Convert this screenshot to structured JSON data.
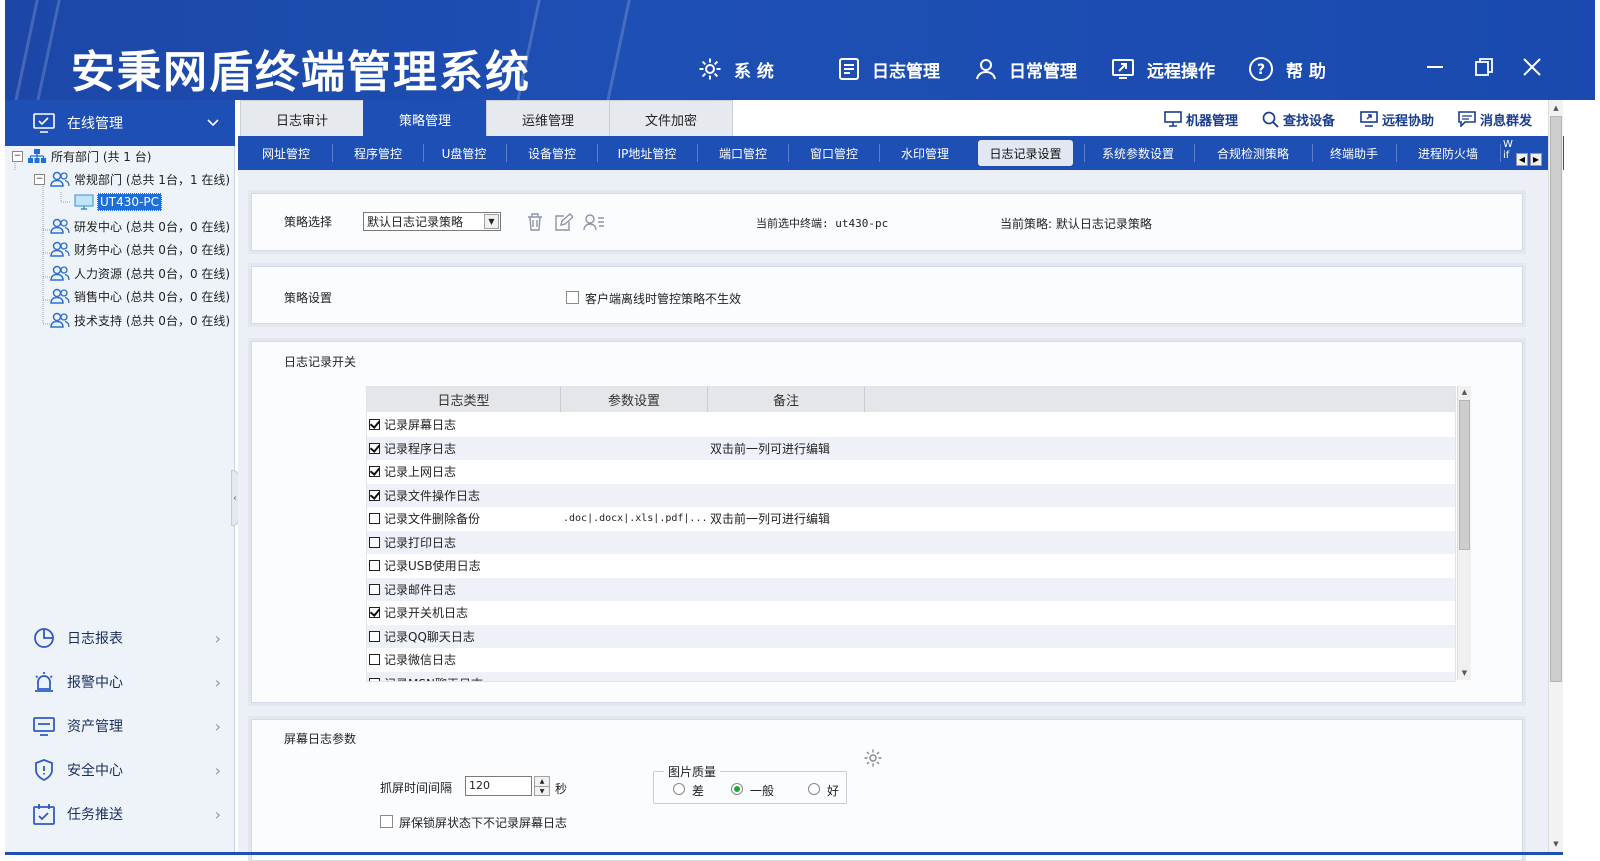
{
  "app": {
    "title": "安秉网盾终端管理系统"
  },
  "header_menu": [
    {
      "label": "系 统",
      "icon": "gear-icon"
    },
    {
      "label": "日志管理",
      "icon": "document-icon"
    },
    {
      "label": "日常管理",
      "icon": "user-icon"
    },
    {
      "label": "远程操作",
      "icon": "remote-icon"
    },
    {
      "label": "帮 助",
      "icon": "help-icon"
    }
  ],
  "sidebar": {
    "online_label": "在线管理",
    "tree": [
      {
        "label": "所有部门 (共 1 台)"
      },
      {
        "label": "常规部门 (总共 1台，1 在线)"
      },
      {
        "label": "UT430-PC"
      },
      {
        "label": "研发中心 (总共 0台，0 在线)"
      },
      {
        "label": "财务中心 (总共 0台，0 在线)"
      },
      {
        "label": "人力资源 (总共 0台，0 在线)"
      },
      {
        "label": "销售中心 (总共 0台，0 在线)"
      },
      {
        "label": "技术支持 (总共 0台，0 在线)"
      }
    ],
    "nav": [
      {
        "label": "日志报表"
      },
      {
        "label": "报警中心"
      },
      {
        "label": "资产管理"
      },
      {
        "label": "安全中心"
      },
      {
        "label": "任务推送"
      }
    ]
  },
  "main_tabs": [
    "日志审计",
    "策略管理",
    "运维管理",
    "文件加密"
  ],
  "toolbar_links": [
    "机器管理",
    "查找设备",
    "远程协助",
    "消息群发"
  ],
  "sub_tabs": [
    "网址管控",
    "程序管控",
    "U盘管控",
    "设备管控",
    "IP地址管控",
    "端口管控",
    "窗口管控",
    "水印管理",
    "日志记录设置",
    "系统参数设置",
    "合规检测策略",
    "终端助手",
    "进程防火墙"
  ],
  "sub_tab_overflow": "W\nif",
  "policy": {
    "select_label": "策略选择",
    "select_value": "默认日志记录策略",
    "current_terminal": "当前选中终端: ut430-pc",
    "current_policy": "当前策略: 默认日志记录策略"
  },
  "policy_settings": {
    "label": "策略设置",
    "offline_checkbox": "客户端离线时管控策略不生效"
  },
  "log_switch": {
    "title": "日志记录开关",
    "columns": [
      "日志类型",
      "参数设置",
      "备注"
    ],
    "rows": [
      {
        "checked": true,
        "type": "记录屏幕日志",
        "param": "",
        "note": ""
      },
      {
        "checked": true,
        "type": "记录程序日志",
        "param": "",
        "note": "双击前一列可进行编辑"
      },
      {
        "checked": true,
        "type": "记录上网日志",
        "param": "",
        "note": ""
      },
      {
        "checked": true,
        "type": "记录文件操作日志",
        "param": "",
        "note": ""
      },
      {
        "checked": false,
        "type": "记录文件删除备份",
        "param": ".doc|.docx|.xls|.pdf|...",
        "note": "双击前一列可进行编辑"
      },
      {
        "checked": false,
        "type": "记录打印日志",
        "param": "",
        "note": ""
      },
      {
        "checked": false,
        "type": "记录USB使用日志",
        "param": "",
        "note": ""
      },
      {
        "checked": false,
        "type": "记录邮件日志",
        "param": "",
        "note": ""
      },
      {
        "checked": true,
        "type": "记录开关机日志",
        "param": "",
        "note": ""
      },
      {
        "checked": false,
        "type": "记录QQ聊天日志",
        "param": "",
        "note": ""
      },
      {
        "checked": false,
        "type": "记录微信日志",
        "param": "",
        "note": ""
      },
      {
        "checked": false,
        "type": "记录MSN聊天日志",
        "param": "",
        "note": ""
      }
    ]
  },
  "screen_params": {
    "title": "屏幕日志参数",
    "interval_label": "抓屏时间间隔",
    "interval_value": "120",
    "interval_unit": "秒",
    "lock_checkbox": "屏保锁屏状态下不记录屏幕日志",
    "quality_title": "图片质量",
    "quality_options": [
      "差",
      "一般",
      "好"
    ],
    "quality_selected": "一般"
  },
  "colors": {
    "brand": "#1e4fb4",
    "accent_green": "#22a63a"
  }
}
